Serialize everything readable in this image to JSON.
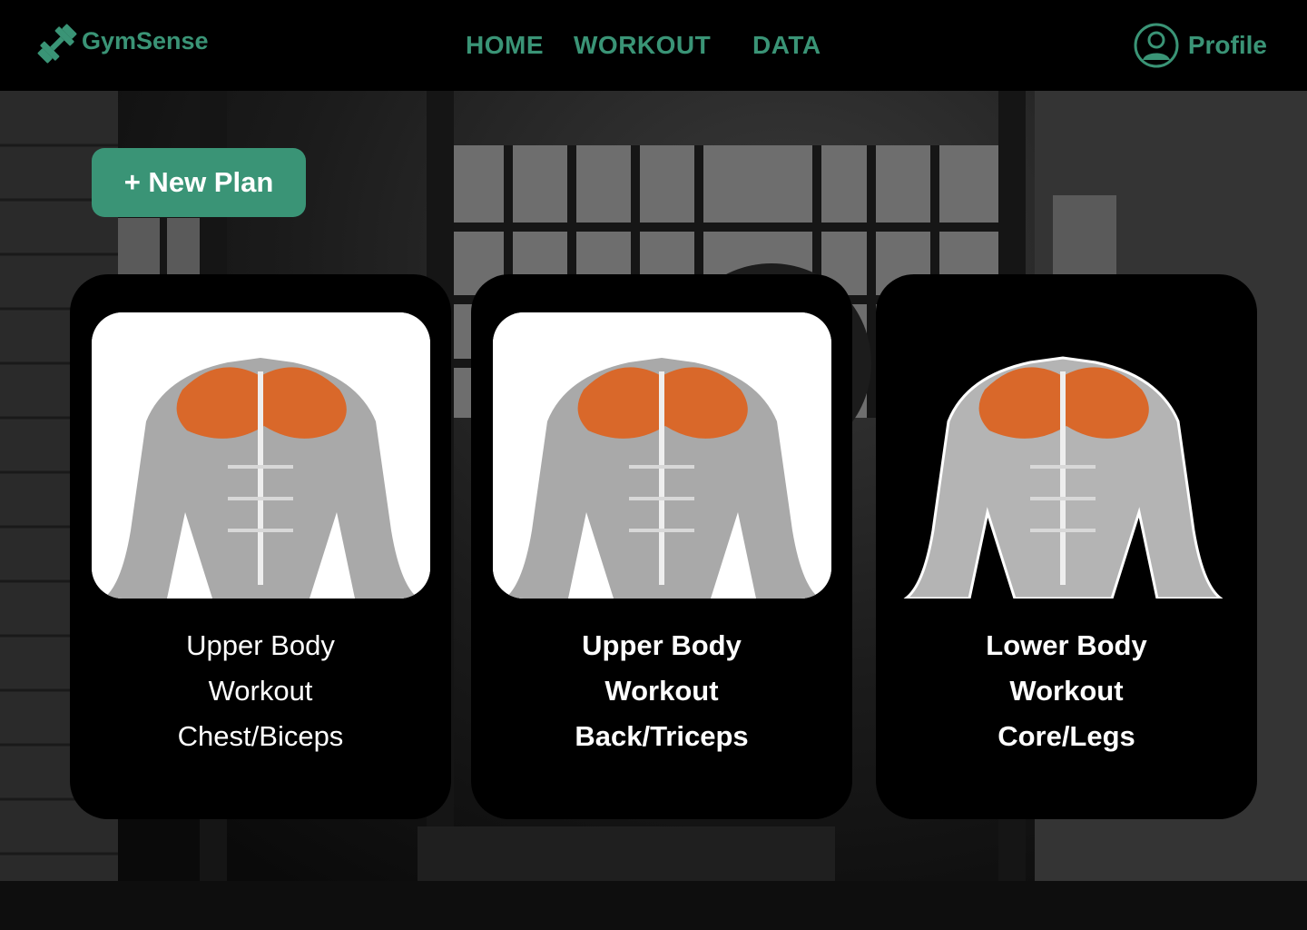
{
  "brand": {
    "name": "GymSense",
    "accent": "#3a9476"
  },
  "nav": {
    "items": [
      "HOME",
      "WORKOUT",
      "DATA"
    ],
    "profile_label": "Profile",
    "profile_icon": "user-circle-icon"
  },
  "actions": {
    "new_plan_label": "+ New Plan"
  },
  "cards": [
    {
      "line1": "Upper Body",
      "line2": "Workout",
      "line3": "Chest/Biceps",
      "image": "chest-muscle-anatomy"
    },
    {
      "line1": "Upper Body",
      "line2": "Workout",
      "line3": "Back/Triceps",
      "image": "chest-muscle-anatomy"
    },
    {
      "line1": "Lower Body",
      "line2": "Workout",
      "line3": "Core/Legs",
      "image": "chest-muscle-anatomy"
    }
  ]
}
